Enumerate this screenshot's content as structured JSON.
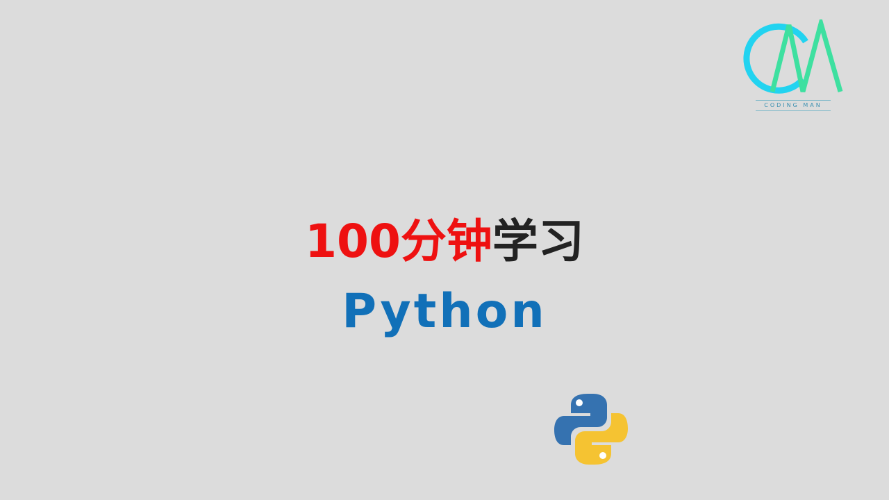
{
  "logo": {
    "text": "CODING MAN",
    "colors": {
      "cyan": "#22d3f0",
      "green": "#3ee0a0"
    }
  },
  "title": {
    "part1": "100分钟",
    "part2": "学习",
    "color_part1": "#ee1111",
    "color_part2": "#222222"
  },
  "subtitle": {
    "text": "Python",
    "color": "#1170b8"
  },
  "python_logo": {
    "icon": "python-logo-icon",
    "colors": {
      "blue": "#3572b0",
      "yellow": "#f5c332"
    }
  },
  "background_color": "#dcdcdc"
}
